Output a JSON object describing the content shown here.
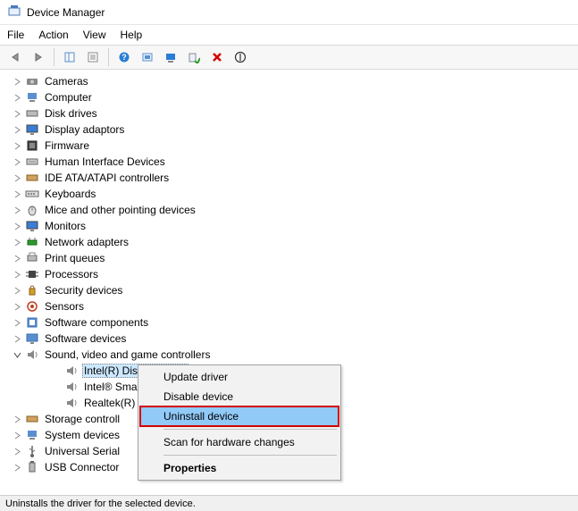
{
  "window": {
    "title": "Device Manager"
  },
  "menu": {
    "file": "File",
    "action": "Action",
    "view": "View",
    "help": "Help"
  },
  "tree": {
    "items": [
      {
        "label": "Cameras",
        "icon": "camera"
      },
      {
        "label": "Computer",
        "icon": "computer"
      },
      {
        "label": "Disk drives",
        "icon": "disk"
      },
      {
        "label": "Display adaptors",
        "icon": "display"
      },
      {
        "label": "Firmware",
        "icon": "firmware"
      },
      {
        "label": "Human Interface Devices",
        "icon": "hid"
      },
      {
        "label": "IDE ATA/ATAPI controllers",
        "icon": "ide"
      },
      {
        "label": "Keyboards",
        "icon": "keyboard"
      },
      {
        "label": "Mice and other pointing devices",
        "icon": "mouse"
      },
      {
        "label": "Monitors",
        "icon": "monitor"
      },
      {
        "label": "Network adapters",
        "icon": "network"
      },
      {
        "label": "Print queues",
        "icon": "printer"
      },
      {
        "label": "Processors",
        "icon": "cpu"
      },
      {
        "label": "Security devices",
        "icon": "security"
      },
      {
        "label": "Sensors",
        "icon": "sensor"
      },
      {
        "label": "Software components",
        "icon": "softcomp"
      },
      {
        "label": "Software devices",
        "icon": "softdev"
      }
    ],
    "soundCategory": "Sound, video and game controllers",
    "soundChildren": [
      "Intel(R) Display Audio",
      "Intel® Smar",
      "Realtek(R) A"
    ],
    "itemsAfter": [
      {
        "label": "Storage controll",
        "icon": "storage"
      },
      {
        "label": "System devices",
        "icon": "system"
      },
      {
        "label": "Universal Serial",
        "icon": "usb"
      },
      {
        "label": "USB Connector",
        "icon": "usbconn"
      }
    ]
  },
  "context": {
    "update": "Update driver",
    "disable": "Disable device",
    "uninstall": "Uninstall device",
    "scan": "Scan for hardware changes",
    "properties": "Properties"
  },
  "status": "Uninstalls the driver for the selected device."
}
